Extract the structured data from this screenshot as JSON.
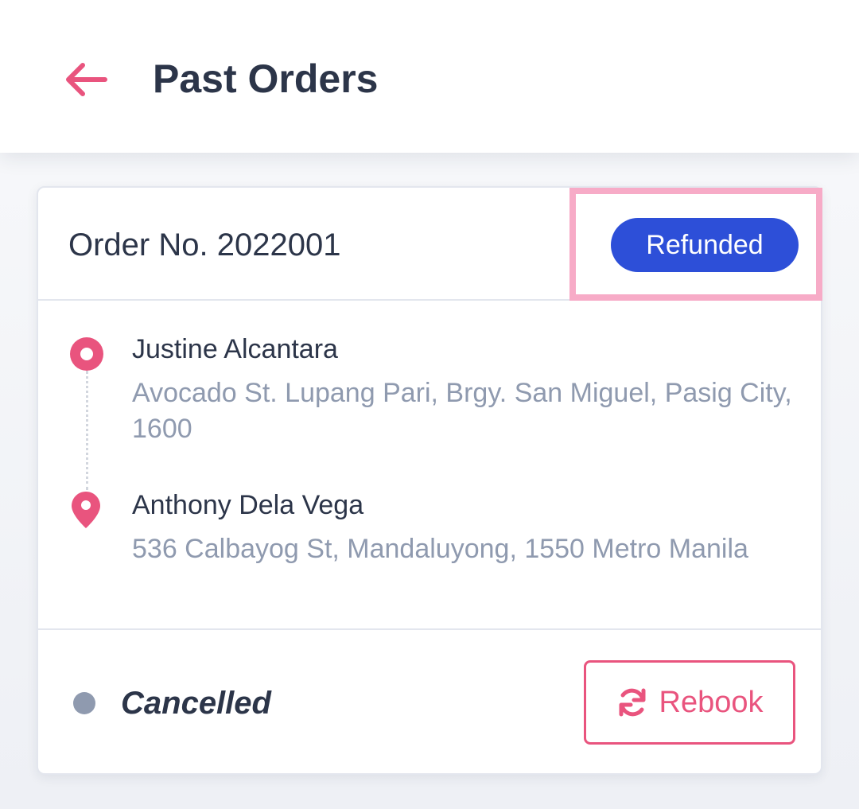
{
  "header": {
    "back_icon": "arrow-left-icon",
    "title": "Past Orders"
  },
  "colors": {
    "accent": "#e9547e",
    "badge": "#2d4fd8",
    "text": "#2c3549",
    "muted": "#8f9aaf"
  },
  "order": {
    "number_label": "Order No. 2022001",
    "refund_badge": "Refunded",
    "origin": {
      "icon": "origin-circle-icon",
      "name": "Justine Alcantara",
      "address": "Avocado St. Lupang Pari, Brgy. San Miguel, Pasig City, 1600"
    },
    "destination": {
      "icon": "map-pin-icon",
      "name": "Anthony Dela Vega",
      "address": "536 Calbayog St, Mandaluyong, 1550 Metro Manila"
    },
    "status": "Cancelled",
    "rebook_icon": "refresh-icon",
    "rebook_label": "Rebook"
  }
}
